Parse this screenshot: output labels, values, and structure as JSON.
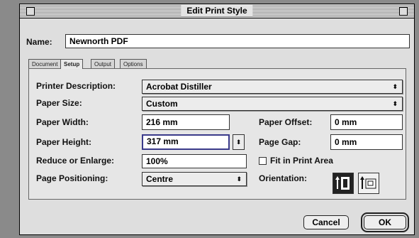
{
  "window": {
    "title": "Edit Print Style"
  },
  "name": {
    "label": "Name:",
    "value": "Newnorth PDF"
  },
  "tabs": [
    {
      "label": "Document",
      "active": false
    },
    {
      "label": "Setup",
      "active": true
    },
    {
      "label": "Output",
      "active": false
    },
    {
      "label": "Options",
      "active": false
    }
  ],
  "setup": {
    "printer_description": {
      "label": "Printer Description:",
      "value": "Acrobat Distiller"
    },
    "paper_size": {
      "label": "Paper Size:",
      "value": "Custom"
    },
    "paper_width": {
      "label": "Paper Width:",
      "value": "216 mm"
    },
    "paper_height": {
      "label": "Paper Height:",
      "value": "317 mm"
    },
    "reduce_enlarge": {
      "label": "Reduce or Enlarge:",
      "value": "100%"
    },
    "page_positioning": {
      "label": "Page Positioning:",
      "value": "Centre"
    },
    "paper_offset": {
      "label": "Paper Offset:",
      "value": "0 mm"
    },
    "page_gap": {
      "label": "Page Gap:",
      "value": "0 mm"
    },
    "fit_in_print_area": {
      "label": "Fit in Print Area",
      "checked": false
    },
    "orientation": {
      "label": "Orientation:",
      "selected": "portrait"
    }
  },
  "buttons": {
    "cancel": "Cancel",
    "ok": "OK"
  },
  "icons": {
    "popup_arrow": "⬍",
    "stepper_arrow": "⬍"
  }
}
